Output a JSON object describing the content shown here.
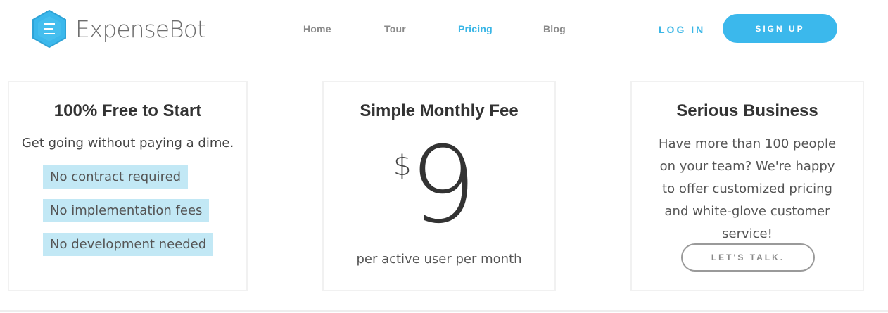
{
  "brand": {
    "name": "ExpenseBot",
    "accent_color": "#3ab6e6"
  },
  "nav": {
    "items": [
      {
        "label": "Home",
        "active": false
      },
      {
        "label": "Tour",
        "active": false
      },
      {
        "label": "Pricing",
        "active": true
      },
      {
        "label": "Blog",
        "active": false
      }
    ],
    "login_label": "LOG IN",
    "signup_label": "SIGN UP"
  },
  "plans": {
    "free": {
      "title": "100% Free to Start",
      "description": "Get going without paying a dime.",
      "features": [
        "No contract required",
        "No implementation fees",
        "No development needed"
      ]
    },
    "monthly": {
      "title": "Simple Monthly Fee",
      "currency": "$",
      "amount": "9",
      "per": "per active user per month"
    },
    "business": {
      "title": "Serious Business",
      "description": "Have more than 100 people on your team? We're happy to offer customized pricing and white-glove customer service!",
      "cta_label": "LET'S TALK."
    }
  }
}
